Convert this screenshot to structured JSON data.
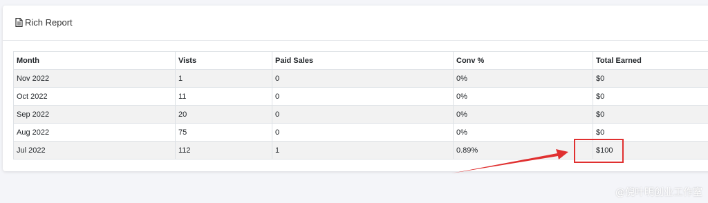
{
  "card": {
    "title": "Rich Report"
  },
  "table": {
    "headers": [
      "Month",
      "Vists",
      "Paid Sales",
      "Conv %",
      "Total Earned"
    ],
    "rows": [
      [
        "Nov 2022",
        "1",
        "0",
        "0%",
        "$0"
      ],
      [
        "Oct 2022",
        "11",
        "0",
        "0%",
        "$0"
      ],
      [
        "Sep 2022",
        "20",
        "0",
        "0%",
        "$0"
      ],
      [
        "Aug 2022",
        "75",
        "0",
        "0%",
        "$0"
      ],
      [
        "Jul 2022",
        "112",
        "1",
        "0.89%",
        "$100"
      ]
    ]
  },
  "annotation": {
    "color": "#e03030"
  },
  "watermark": {
    "text": "@倪叶明创业工作室"
  }
}
